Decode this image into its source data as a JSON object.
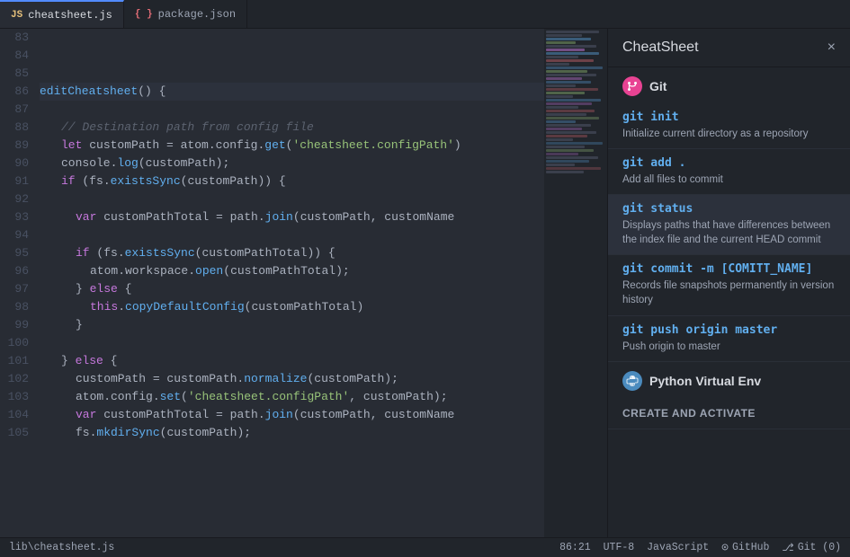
{
  "tabs": [
    {
      "label": "cheatsheet.js",
      "type": "js",
      "active": true
    },
    {
      "label": "package.json",
      "type": "json",
      "active": false
    }
  ],
  "editor": {
    "startLine": 83,
    "lines": [
      {
        "num": 83,
        "content": ""
      },
      {
        "num": 84,
        "content": ""
      },
      {
        "num": 85,
        "content": ""
      },
      {
        "num": 86,
        "content": "editCheatsheet() {",
        "highlight": true
      },
      {
        "num": 87,
        "content": ""
      },
      {
        "num": 88,
        "content": "  // Destination path from config file",
        "type": "comment"
      },
      {
        "num": 89,
        "content": "  let customPath = atom.config.get('cheatsheet.configPath')"
      },
      {
        "num": 90,
        "content": "  console.log(customPath);"
      },
      {
        "num": 91,
        "content": "  if (fs.existsSync(customPath)) {"
      },
      {
        "num": 92,
        "content": ""
      },
      {
        "num": 93,
        "content": "    var customPathTotal = path.join(customPath, customName"
      },
      {
        "num": 94,
        "content": ""
      },
      {
        "num": 95,
        "content": "    if (fs.existsSync(customPathTotal)) {"
      },
      {
        "num": 96,
        "content": "      atom.workspace.open(customPathTotal);"
      },
      {
        "num": 97,
        "content": "    } else {"
      },
      {
        "num": 98,
        "content": "      this.copyDefaultConfig(customPathTotal)"
      },
      {
        "num": 99,
        "content": "    }"
      },
      {
        "num": 100,
        "content": ""
      },
      {
        "num": 101,
        "content": "  } else {"
      },
      {
        "num": 102,
        "content": "    customPath = customPath.normalize(customPath);"
      },
      {
        "num": 103,
        "content": "    atom.config.set('cheatsheet.configPath', customPath);"
      },
      {
        "num": 104,
        "content": "    var customPathTotal = path.join(customPath, customName"
      },
      {
        "num": 105,
        "content": "    fs.mkdirSync(customPath);"
      }
    ]
  },
  "cheatsheet": {
    "title": "CheatSheet",
    "close_label": "×",
    "sections": [
      {
        "name": "Git",
        "icon_type": "git",
        "items": [
          {
            "command": "git init",
            "description": "Initialize current directory as a repository"
          },
          {
            "command": "git add .",
            "description": "Add all files to commit"
          },
          {
            "command": "git status",
            "description": "Displays paths that have differences between the index file and the current HEAD commit",
            "active": true
          },
          {
            "command": "git commit -m [COMITT_NAME]",
            "description": "Records file snapshots permanently in version history"
          },
          {
            "command": "git push origin master",
            "description": "Push origin to master"
          }
        ]
      },
      {
        "name": "Python Virtual Env",
        "icon_type": "python",
        "items": [],
        "subsection": "CREATE AND ACTIVATE"
      }
    ]
  },
  "statusbar": {
    "file_path": "lib\\cheatsheet.js",
    "position": "86:21",
    "encoding": "UTF-8",
    "language": "JavaScript",
    "github_label": "GitHub",
    "git_label": "Git (0)"
  }
}
